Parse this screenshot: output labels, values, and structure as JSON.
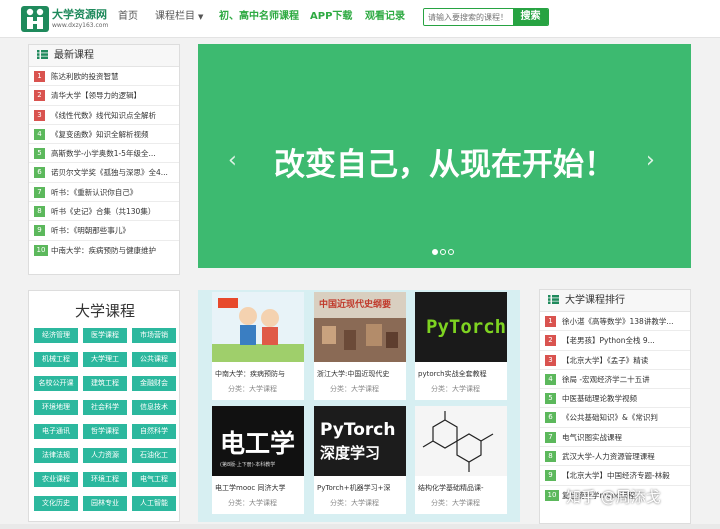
{
  "header": {
    "logo_title": "大学资源网",
    "logo_url": "www.dxzy163.com",
    "nav": {
      "home": "首页",
      "courses": "课程栏目",
      "teachers": "初、高中名师课程",
      "app": "APP下载",
      "history": "观看记录"
    },
    "search": {
      "placeholder": "请输入要搜索的课程！",
      "button": "搜索"
    }
  },
  "latest": {
    "title": "最新课程",
    "items": [
      {
        "n": "1",
        "t": "陈达利欧的投资智慧"
      },
      {
        "n": "2",
        "t": "清华大学【领导力的逻辑】"
      },
      {
        "n": "3",
        "t": "《线性代数》线代知识点全解析"
      },
      {
        "n": "4",
        "t": "《复变函数》知识全解析视频"
      },
      {
        "n": "5",
        "t": "高斯数学-小学奥数1-5年级全..."
      },
      {
        "n": "6",
        "t": "诺贝尔文学奖《孤独与深思》全4..."
      },
      {
        "n": "7",
        "t": "听书：《重新认识你自己》"
      },
      {
        "n": "8",
        "t": "听书《史记》合集（共130集）"
      },
      {
        "n": "9",
        "t": "听书：《明朝那些事儿》"
      },
      {
        "n": "10",
        "t": "中南大学：疾病预防与健康维护"
      }
    ]
  },
  "banner": {
    "text": "改变自己，从现在开始！",
    "prev": "‹",
    "next": "›"
  },
  "categories": {
    "title": "大学课程",
    "tags": [
      "经济管理",
      "医学课程",
      "市场营销",
      "机械工程",
      "大学理工",
      "公共课程",
      "名校公开课",
      "建筑工程",
      "金融财会",
      "环境地理",
      "社会科学",
      "信息技术",
      "电子通讯",
      "哲学课程",
      "自然科学",
      "法律法规",
      "人力资源",
      "石油化工",
      "农业课程",
      "环境工程",
      "电气工程",
      "文化历史",
      "园林专业",
      "人工智能"
    ]
  },
  "cards": [
    {
      "title": "中南大学：疾病预防与",
      "category": "分类：大学课程"
    },
    {
      "title": "浙江大学:中国近现代史",
      "category": "分类：大学课程"
    },
    {
      "title": "pytorch实战全套教程",
      "category": "分类：大学课程"
    },
    {
      "title": "电工学mooc 同济大学",
      "category": "分类：大学课程"
    },
    {
      "title": "PyTorch+机器学习+深",
      "category": "分类：大学课程"
    },
    {
      "title": "结构化学基础精品课-",
      "category": "分类：大学课程"
    }
  ],
  "thumbs": {
    "t2": "中国近现代史纲要",
    "t3": "PyTorch",
    "t4_main": "电工学",
    "t4_sub": "(第8版·上下册)·本科教学",
    "t5_a": "PyTorch",
    "t5_b": "深度学习"
  },
  "ranking": {
    "title": "大学课程排行",
    "items": [
      {
        "n": "1",
        "t": "徐小湛《高等数学》138讲教学..."
      },
      {
        "n": "2",
        "t": "【老男孩】Python全栈 9..."
      },
      {
        "n": "3",
        "t": "【北京大学】《孟子》精读"
      },
      {
        "n": "4",
        "t": "徐局 -宏观经济学二十五讲"
      },
      {
        "n": "5",
        "t": "中医基础理论教学视频"
      },
      {
        "n": "6",
        "t": "《公共基础知识》&《常识判"
      },
      {
        "n": "7",
        "t": "电气识图实战课程"
      },
      {
        "n": "8",
        "t": "武汉大学-人力资源管理课程"
      },
      {
        "n": "9",
        "t": "【北京大学】中国经济专题-林毅"
      },
      {
        "n": "10",
        "t": "复旦统计学mooc课程"
      }
    ]
  },
  "watermark": "知乎 @周添戈",
  "colors": {
    "brand": "#27a342",
    "banner": "#3dba70",
    "tag": "#2cb89e",
    "rank_top": "#d9534f",
    "rank_rest": "#5cb85c"
  }
}
